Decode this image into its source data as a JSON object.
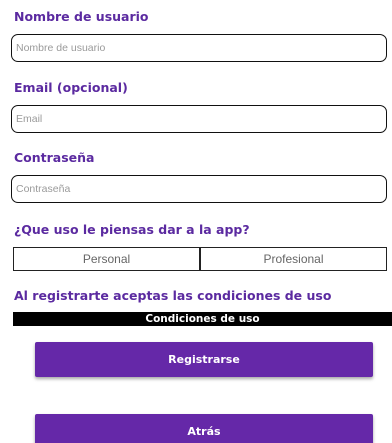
{
  "form": {
    "username": {
      "label": "Nombre de usuario",
      "placeholder": "Nombre de usuario",
      "value": ""
    },
    "email": {
      "label": "Email (opcional)",
      "placeholder": "Email",
      "value": ""
    },
    "password": {
      "label": "Contraseña",
      "placeholder": "Contraseña",
      "value": ""
    },
    "usage": {
      "question": "¿Que uso le piensas dar a la app?",
      "options": [
        "Personal",
        "Profesional"
      ]
    },
    "terms_notice": "Al registrarte aceptas las condiciones de uso",
    "terms_button": "Condiciones de uso",
    "register_button": "Registrarse",
    "back_button": "Atrás"
  },
  "colors": {
    "accent": "#5b2aa0",
    "button": "#6528a8",
    "terms_bar": "#000000"
  }
}
